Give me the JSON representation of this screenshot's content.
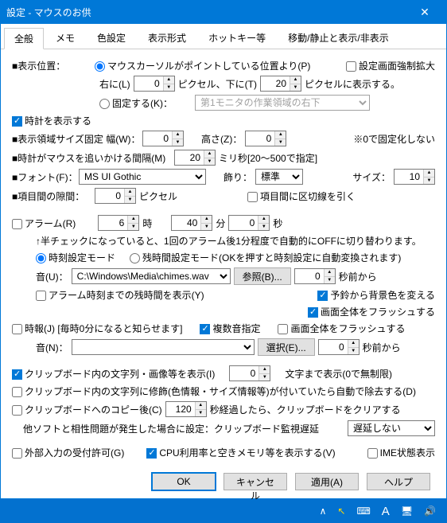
{
  "window": {
    "title": "設定 - マウスのお供"
  },
  "tabs": [
    "全般",
    "メモ",
    "色設定",
    "表示形式",
    "ホットキー等",
    "移動/静止と表示/非表示"
  ],
  "dispPos": {
    "label": "■表示位置：",
    "radio1": "マウスカーソルがポイントしている位置より(P)",
    "forceExpand": "設定画面強制拡大",
    "rightLabel": "右に(L)",
    "rightVal": "0",
    "pxDown": "ピクセル、下に(T)",
    "downVal": "20",
    "pxShow": "ピクセルに表示する。",
    "radio2": "固定する(K)：",
    "fixedSel": "第1モニタの作業領域の右下"
  },
  "clock": {
    "show": "時計を表示する",
    "areaLabel": "■表示領域サイズ固定 幅(W)：",
    "wVal": "0",
    "hLabel": "高さ(Z)：",
    "hVal": "0",
    "note": "※0で固定化しない",
    "followLabel": "■時計がマウスを追いかける間隔(M)",
    "followVal": "20",
    "followUnit": "ミリ秒[20～500で指定]"
  },
  "font": {
    "label": "■フォント(F)：",
    "name": "MS UI Gothic",
    "decoLabel": "飾り：",
    "decoVal": "標準",
    "sizeLabel": "サイズ：",
    "sizeVal": "10"
  },
  "gap": {
    "label": "■項目間の隙間：",
    "val": "0",
    "unit": "ピクセル",
    "divider": "項目間に区切線を引く"
  },
  "alarm": {
    "label": "アラーム(R)",
    "hVal": "6",
    "hUnit": "時",
    "mVal": "40",
    "mUnit": "分",
    "sVal": "0",
    "sUnit": "秒",
    "note": "↑半チェックになっていると、1回のアラーム後1分程度で自動的にOFFに切り替わります。",
    "mode1": "時刻設定モード",
    "mode2": "残時間設定モード(OKを押すと時刻設定に自動変換されます)",
    "soundLabel": "音(U)：",
    "soundPath": "C:\\Windows\\Media\\chimes.wav",
    "refBtn": "参照(B)...",
    "offsetVal": "0",
    "offsetUnit": "秒前から",
    "remain": "アラーム時刻までの残時間を表示(Y)",
    "bgChange": "予鈴から背景色を変える",
    "flash": "画面全体をフラッシュする"
  },
  "hourly": {
    "label": "時報(J) [毎時0分になると知らせます]",
    "multi": "複数音指定",
    "flash": "画面全体をフラッシュする",
    "soundLabel": "音(N)：",
    "soundPath": "",
    "selBtn": "選択(E)...",
    "offsetVal": "0",
    "offsetUnit": "秒前から"
  },
  "clip": {
    "showText": "クリップボード内の文字列・画像等を表示(I)",
    "showVal": "0",
    "showUnit": "文字まで表示(0で無制限)",
    "decorate": "クリップボード内の文字列に修飾(色情報・サイズ情報等)が付いていたら自動で除去する(D)",
    "copyLater": "クリップボードへのコピー後(C)",
    "copyVal": "120",
    "copyUnit": "秒経過したら、クリップボードをクリアする",
    "compat": "他ソフトと相性問題が発生した場合に設定：クリップボード監視遅延",
    "compatVal": "遅延しない"
  },
  "bottom": {
    "extInput": "外部入力の受付許可(G)",
    "cpu": "CPU利用率と空きメモリ等を表示する(V)",
    "ime": "IME状態表示"
  },
  "buttons": {
    "ok": "OK",
    "cancel": "キャンセル",
    "apply": "適用(A)",
    "help": "ヘルプ"
  },
  "tray": {
    "chev": "∧",
    "cursor": "↖",
    "kbd": "⌨",
    "a": "A",
    "mon": "🖥",
    "snd": "🔊"
  }
}
